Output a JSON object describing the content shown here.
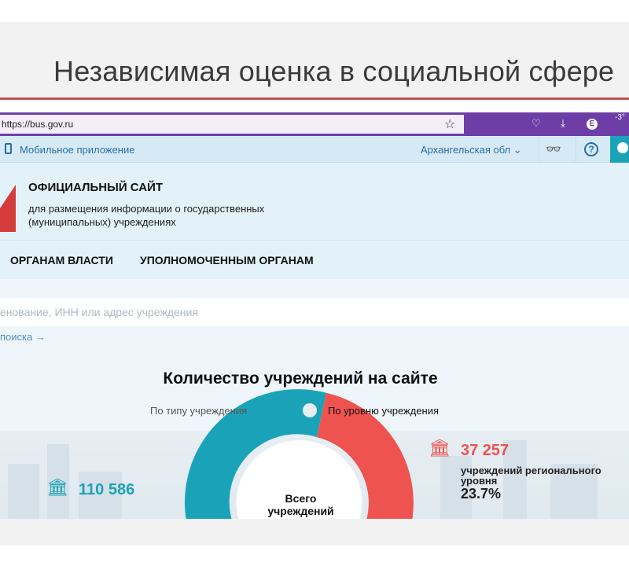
{
  "slide": {
    "title": "Независимая оценка в социальной сфере"
  },
  "browser": {
    "url": "https://bus.gov.ru",
    "weather": "-3°"
  },
  "topnav": {
    "mobile_label": "Мобильное приложение",
    "region_label": "Архангельская обл"
  },
  "site": {
    "title": "ОФИЦИАЛЬНЫЙ САЙТ",
    "subtitle": "для размещения информации о государственных (муниципальных) учреждениях"
  },
  "mainnav": {
    "items": [
      "ОРГАНАМ ВЛАСТИ",
      "УПОЛНОМОЧЕННЫМ ОРГАНАМ"
    ]
  },
  "search": {
    "placeholder": "енование, ИНН или адрес учреждения",
    "advanced_link": "поиска →"
  },
  "stats": {
    "title": "Количество учреждений на сайте",
    "toggle_left": "По типу учреждения",
    "toggle_right": "По уровню учреждения",
    "total_label": "Всего учреждений",
    "regional": {
      "value": "37 257",
      "label": "учреждений регионального уровня",
      "percent": "23.7%"
    },
    "other": {
      "value": "110 586"
    }
  },
  "colors": {
    "accent_red": "#ef5350",
    "accent_teal": "#1aa3b8",
    "browser_purple": "#6d3fa6",
    "slide_rule": "#c0504d"
  },
  "icons": {
    "institution": "classical-building-icon",
    "help": "question-icon",
    "glasses": "accessibility-glasses-icon"
  }
}
